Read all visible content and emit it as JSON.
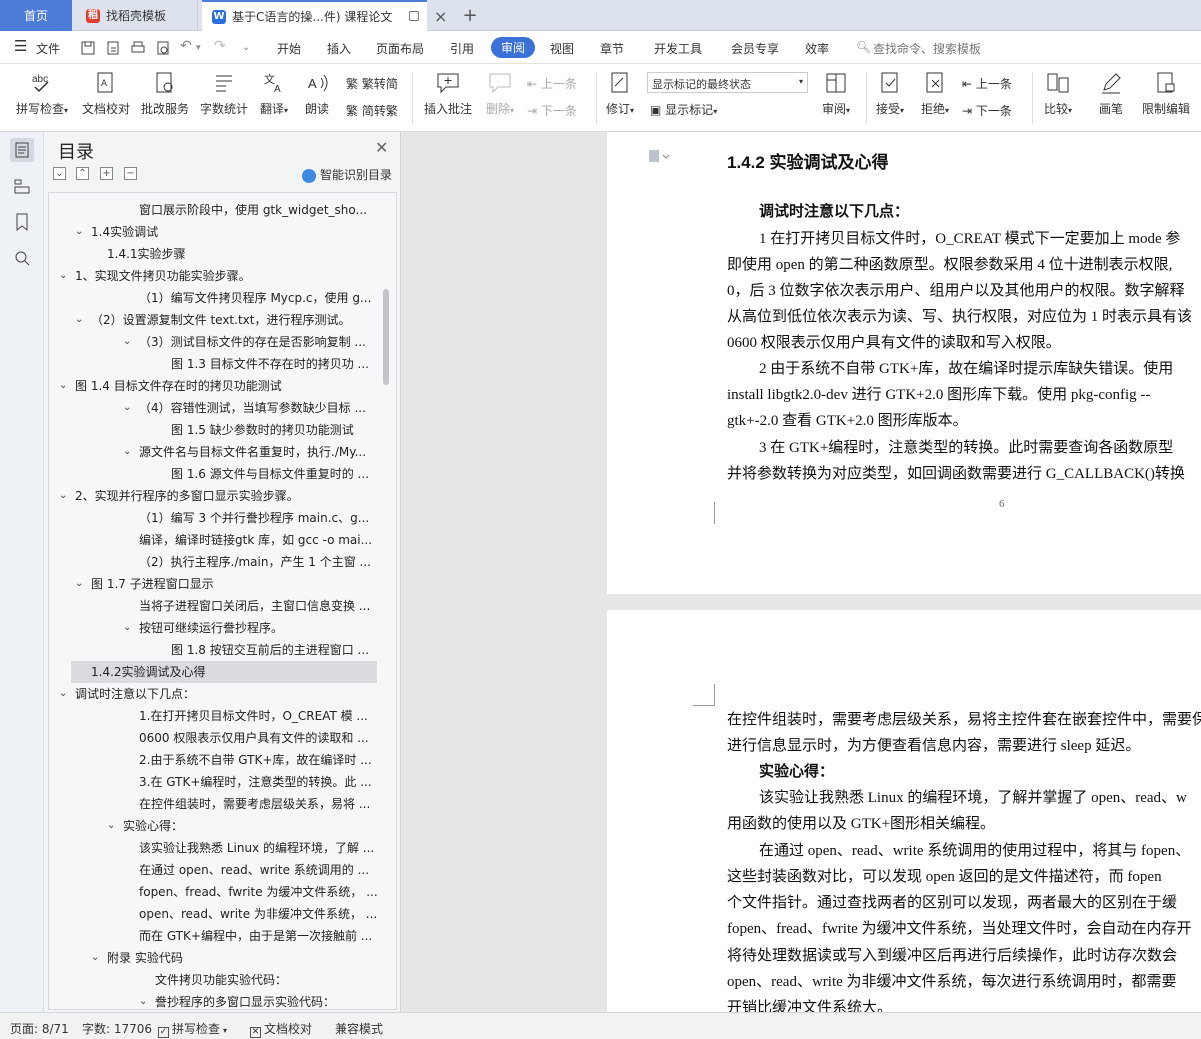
{
  "tabs": {
    "home": "首页",
    "template": "找稻壳模板",
    "doc": "基于C语言的操...件)  课程论文"
  },
  "menu": {
    "file": "文件",
    "items": [
      "开始",
      "插入",
      "页面布局",
      "引用",
      "审阅",
      "视图",
      "章节",
      "开发工具",
      "会员专享",
      "效率"
    ],
    "search": "查找命令、搜索模板"
  },
  "ribbon": {
    "spell": "拼写检查",
    "doccheck": "文档校对",
    "batch": "批改服务",
    "wordcount": "字数统计",
    "translate": "翻译",
    "read": "朗读",
    "trad": "繁转简",
    "simp": "简转繁",
    "insert_comment": "插入批注",
    "delete": "删除",
    "prev": "上一条",
    "next": "下一条",
    "track": "修订",
    "markup_state": "显示标记的最终状态",
    "show_markup": "显示标记",
    "review": "审阅",
    "accept": "接受",
    "reject": "拒绝",
    "prev2": "上一条",
    "next2": "下一条",
    "compare": "比较",
    "pen": "画笔",
    "restrict": "限制编辑"
  },
  "toc": {
    "title": "目录",
    "smart": "智能识别目录",
    "items": [
      {
        "text": "窗口展示阶段中，使用 gtk_widget_sho..."
      },
      {
        "text": "1.4实验调试"
      },
      {
        "text": "1.4.1实验步骤"
      },
      {
        "text": "1、实现文件拷贝功能实验步骤。"
      },
      {
        "text": "（1）编写文件拷贝程序 Mycp.c，使用 g..."
      },
      {
        "text": "（2）设置源复制文件 text.txt，进行程序测试。"
      },
      {
        "text": "（3）测试目标文件的存在是否影响复制 ..."
      },
      {
        "text": "图 1.3 目标文件不存在时的拷贝功 ..."
      },
      {
        "text": "图 1.4 目标文件存在时的拷贝功能测试"
      },
      {
        "text": "（4）容错性测试，当填写参数缺少目标 ..."
      },
      {
        "text": "图 1.5 缺少参数时的拷贝功能测试"
      },
      {
        "text": "源文件名与目标文件名重复时，执行./My..."
      },
      {
        "text": "图 1.6 源文件与目标文件重复时的 ..."
      },
      {
        "text": "2、实现并行程序的多窗口显示实验步骤。"
      },
      {
        "text": "（1）编写 3 个并行誊抄程序 main.c、g..."
      },
      {
        "text": "编译，编译时链接gtk 库，如 gcc -o mai..."
      },
      {
        "text": "（2）执行主程序./main，产生 1 个主窗 ..."
      },
      {
        "text": "图 1.7 子进程窗口显示"
      },
      {
        "text": "当将子进程窗口关闭后，主窗口信息变换 ..."
      },
      {
        "text": "按钮可继续运行誊抄程序。"
      },
      {
        "text": "图 1.8 按钮交互前后的主进程窗口 ..."
      },
      {
        "text": "1.4.2实验调试及心得"
      },
      {
        "text": "调试时注意以下几点："
      },
      {
        "text": "1.在打开拷贝目标文件时，O_CREAT 模 ..."
      },
      {
        "text": "0600 权限表示仅用户具有文件的读取和 ..."
      },
      {
        "text": "2.由于系统不自带 GTK+库，故在编译时 ..."
      },
      {
        "text": "3.在 GTK+编程时，注意类型的转换。此 ..."
      },
      {
        "text": "在控件组装时，需要考虑层级关系，易将 ..."
      },
      {
        "text": "实验心得："
      },
      {
        "text": "该实验让我熟悉 Linux 的编程环境，了解 ..."
      },
      {
        "text": "在通过 open、read、write 系统调用的 ..."
      },
      {
        "text": "fopen、fread、fwrite 为缓冲文件系统， ..."
      },
      {
        "text": "open、read、write 为非缓冲文件系统， ..."
      },
      {
        "text": "而在 GTK+编程中，由于是第一次接触前 ..."
      },
      {
        "text": "附录 实验代码"
      },
      {
        "text": "文件拷贝功能实验代码："
      },
      {
        "text": "誊抄程序的多窗口显示实验代码："
      }
    ]
  },
  "page1": {
    "heading": "1.4.2   实验调试及心得",
    "sub": "调试时注意以下几点：",
    "lines": [
      "1  在打开拷贝目标文件时，O_CREAT 模式下一定要加上  mode 参",
      "即使用  open 的第二种函数原型。权限参数采用  4 位十进制表示权限,",
      "0，后 3 位数字依次表示用户、组用户以及其他用户的权限。数字解释",
      "从高位到低位依次表示为读、写、执行权限，对应位为  1 时表示具有该",
      "0600 权限表示仅用户具有文件的读取和写入权限。",
      "2  由于系统不自带  GTK+库，故在编译时提示库缺失错误。使用",
      "install libgtk2.0-dev 进行  GTK+2.0 图形库下载。使用  pkg-config --",
      "gtk+-2.0 查看 GTK+2.0 图形库版本。",
      "3  在 GTK+编程时，注意类型的转换。此时需要查询各函数原型",
      "并将参数转换为对应类型，如回调函数需要进行  G_CALLBACK()转换"
    ],
    "page_no": "6"
  },
  "page2": {
    "lines": [
      "在控件组装时，需要考虑层级关系，易将主控件套在嵌套控件中，需要保",
      "进行信息显示时，为方便查看信息内容，需要进行  sleep 延迟。",
      "实验心得：",
      "该实验让我熟悉  Linux 的编程环境，了解并掌握了  open、read、w",
      "用函数的使用以及  GTK+图形相关编程。",
      "在通过  open、read、write 系统调用的使用过程中，将其与  fopen、",
      "这些封装函数对比，可以发现  open 返回的是文件描述符，而  fopen",
      "个文件指针。通过查找两者的区别可以发现，两者最大的区别在于缓",
      "fopen、fread、fwrite 为缓冲文件系统，当处理文件时，会自动在内存开",
      "将待处理数据读或写入到缓冲区后再进行后续操作，此时访存次数会",
      "open、read、write 为非缓冲文件系统，每次进行系统调用时，都需要",
      "开销比缓冲文件系统大。"
    ]
  },
  "status": {
    "page": "页面: 8/71",
    "words": "字数: 17706",
    "spell": "拼写检查",
    "doccheck": "文档校对",
    "compat": "兼容模式"
  }
}
